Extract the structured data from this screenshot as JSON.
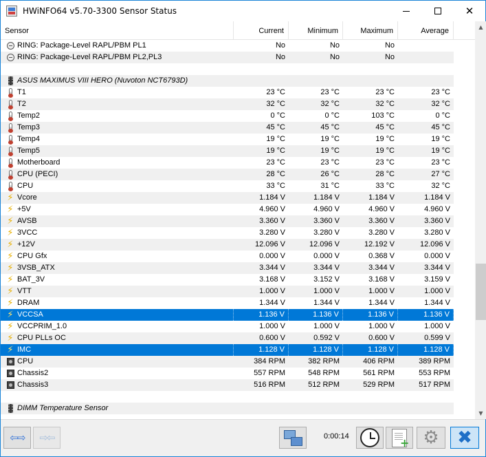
{
  "window": {
    "title": "HWiNFO64 v5.70-3300 Sensor Status"
  },
  "columns": {
    "sensor": "Sensor",
    "current": "Current",
    "minimum": "Minimum",
    "maximum": "Maximum",
    "average": "Average"
  },
  "rows": [
    {
      "kind": "data",
      "icon": "clock",
      "label": "RING: Package-Level RAPL/PBM PL1",
      "current": "No",
      "minimum": "No",
      "maximum": "No",
      "average": ""
    },
    {
      "kind": "data",
      "icon": "clock",
      "label": "RING: Package-Level RAPL/PBM PL2,PL3",
      "current": "No",
      "minimum": "No",
      "maximum": "No",
      "average": ""
    },
    {
      "kind": "blank",
      "label": "",
      "current": "",
      "minimum": "",
      "maximum": "",
      "average": ""
    },
    {
      "kind": "group",
      "icon": "chip",
      "label": "ASUS MAXIMUS VIII HERO (Nuvoton NCT6793D)",
      "current": "",
      "minimum": "",
      "maximum": "",
      "average": ""
    },
    {
      "kind": "data",
      "icon": "therm",
      "label": "T1",
      "current": "23 °C",
      "minimum": "23 °C",
      "maximum": "23 °C",
      "average": "23 °C"
    },
    {
      "kind": "data",
      "icon": "therm",
      "label": "T2",
      "current": "32 °C",
      "minimum": "32 °C",
      "maximum": "32 °C",
      "average": "32 °C"
    },
    {
      "kind": "data",
      "icon": "therm",
      "label": "Temp2",
      "current": "0 °C",
      "minimum": "0 °C",
      "maximum": "103 °C",
      "average": "0 °C"
    },
    {
      "kind": "data",
      "icon": "therm",
      "label": "Temp3",
      "current": "45 °C",
      "minimum": "45 °C",
      "maximum": "45 °C",
      "average": "45 °C"
    },
    {
      "kind": "data",
      "icon": "therm",
      "label": "Temp4",
      "current": "19 °C",
      "minimum": "19 °C",
      "maximum": "19 °C",
      "average": "19 °C"
    },
    {
      "kind": "data",
      "icon": "therm",
      "label": "Temp5",
      "current": "19 °C",
      "minimum": "19 °C",
      "maximum": "19 °C",
      "average": "19 °C"
    },
    {
      "kind": "data",
      "icon": "therm",
      "label": "Motherboard",
      "current": "23 °C",
      "minimum": "23 °C",
      "maximum": "23 °C",
      "average": "23 °C"
    },
    {
      "kind": "data",
      "icon": "therm",
      "label": "CPU (PECI)",
      "current": "28 °C",
      "minimum": "26 °C",
      "maximum": "28 °C",
      "average": "27 °C"
    },
    {
      "kind": "data",
      "icon": "therm",
      "label": "CPU",
      "current": "33 °C",
      "minimum": "31 °C",
      "maximum": "33 °C",
      "average": "32 °C"
    },
    {
      "kind": "data",
      "icon": "bolt",
      "label": "Vcore",
      "current": "1.184 V",
      "minimum": "1.184 V",
      "maximum": "1.184 V",
      "average": "1.184 V"
    },
    {
      "kind": "data",
      "icon": "bolt",
      "label": "+5V",
      "current": "4.960 V",
      "minimum": "4.960 V",
      "maximum": "4.960 V",
      "average": "4.960 V"
    },
    {
      "kind": "data",
      "icon": "bolt",
      "label": "AVSB",
      "current": "3.360 V",
      "minimum": "3.360 V",
      "maximum": "3.360 V",
      "average": "3.360 V"
    },
    {
      "kind": "data",
      "icon": "bolt",
      "label": "3VCC",
      "current": "3.280 V",
      "minimum": "3.280 V",
      "maximum": "3.280 V",
      "average": "3.280 V"
    },
    {
      "kind": "data",
      "icon": "bolt",
      "label": "+12V",
      "current": "12.096 V",
      "minimum": "12.096 V",
      "maximum": "12.192 V",
      "average": "12.096 V"
    },
    {
      "kind": "data",
      "icon": "bolt",
      "label": "CPU Gfx",
      "current": "0.000 V",
      "minimum": "0.000 V",
      "maximum": "0.368 V",
      "average": "0.000 V"
    },
    {
      "kind": "data",
      "icon": "bolt",
      "label": "3VSB_ATX",
      "current": "3.344 V",
      "minimum": "3.344 V",
      "maximum": "3.344 V",
      "average": "3.344 V"
    },
    {
      "kind": "data",
      "icon": "bolt",
      "label": "BAT_3V",
      "current": "3.168 V",
      "minimum": "3.152 V",
      "maximum": "3.168 V",
      "average": "3.159 V"
    },
    {
      "kind": "data",
      "icon": "bolt",
      "label": "VTT",
      "current": "1.000 V",
      "minimum": "1.000 V",
      "maximum": "1.000 V",
      "average": "1.000 V"
    },
    {
      "kind": "data",
      "icon": "bolt",
      "label": "DRAM",
      "current": "1.344 V",
      "minimum": "1.344 V",
      "maximum": "1.344 V",
      "average": "1.344 V"
    },
    {
      "kind": "selected",
      "icon": "bolt",
      "label": "VCCSA",
      "current": "1.136 V",
      "minimum": "1.136 V",
      "maximum": "1.136 V",
      "average": "1.136 V"
    },
    {
      "kind": "data",
      "icon": "bolt",
      "label": "VCCPRIM_1.0",
      "current": "1.000 V",
      "minimum": "1.000 V",
      "maximum": "1.000 V",
      "average": "1.000 V"
    },
    {
      "kind": "data",
      "icon": "bolt",
      "label": "CPU PLLs OC",
      "current": "0.600 V",
      "minimum": "0.592 V",
      "maximum": "0.600 V",
      "average": "0.599 V"
    },
    {
      "kind": "selected",
      "icon": "bolt",
      "label": "IMC",
      "current": "1.128 V",
      "minimum": "1.128 V",
      "maximum": "1.128 V",
      "average": "1.128 V"
    },
    {
      "kind": "data",
      "icon": "fan",
      "label": "CPU",
      "current": "384 RPM",
      "minimum": "382 RPM",
      "maximum": "406 RPM",
      "average": "389 RPM"
    },
    {
      "kind": "data",
      "icon": "fan",
      "label": "Chassis2",
      "current": "557 RPM",
      "minimum": "548 RPM",
      "maximum": "561 RPM",
      "average": "553 RPM"
    },
    {
      "kind": "data",
      "icon": "fan",
      "label": "Chassis3",
      "current": "516 RPM",
      "minimum": "512 RPM",
      "maximum": "529 RPM",
      "average": "517 RPM"
    },
    {
      "kind": "blank",
      "label": "",
      "current": "",
      "minimum": "",
      "maximum": "",
      "average": ""
    },
    {
      "kind": "group",
      "icon": "chip",
      "label": "DIMM Temperature Sensor",
      "current": "",
      "minimum": "",
      "maximum": "",
      "average": ""
    }
  ],
  "footer": {
    "elapsed_time": "0:00:14"
  },
  "colors": {
    "selection": "#0078d7",
    "window_border": "#1883d7"
  }
}
